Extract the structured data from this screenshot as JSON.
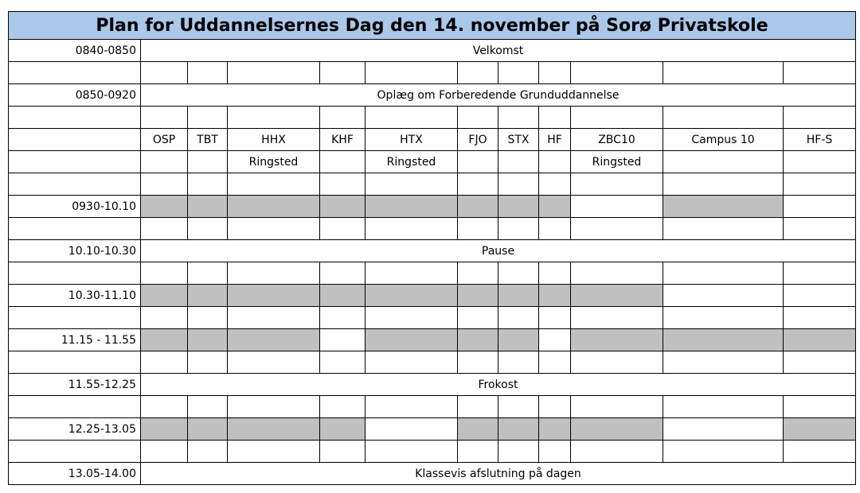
{
  "title": "Plan for Uddannelsernes Dag den 14. november på Sorø Privatskole",
  "columns": [
    "OSP",
    "TBT",
    "HHX",
    "KHF",
    "HTX",
    "FJO",
    "STX",
    "HF",
    "ZBC10",
    "Campus 10",
    "HF-S"
  ],
  "locations": [
    "",
    "",
    "Ringsted",
    "",
    "Ringsted",
    "",
    "",
    "",
    "Ringsted",
    "",
    ""
  ],
  "rows": [
    {
      "time": "0840-0850",
      "label": "Velkomst"
    },
    {
      "time": "",
      "cells": [
        0,
        0,
        0,
        0,
        0,
        0,
        0,
        0,
        0,
        0,
        0
      ]
    },
    {
      "time": "0850-0920",
      "label": "Oplæg om Forberedende Grunduddannelse"
    },
    {
      "time": "",
      "cells": [
        0,
        0,
        0,
        0,
        0,
        0,
        0,
        0,
        0,
        0,
        0
      ]
    },
    {
      "time": "",
      "header": "columns"
    },
    {
      "time": "",
      "header": "locations"
    },
    {
      "time": "",
      "cells": [
        0,
        0,
        0,
        0,
        0,
        0,
        0,
        0,
        0,
        0,
        0
      ]
    },
    {
      "time": "0930-10.10",
      "cells": [
        1,
        1,
        1,
        1,
        1,
        1,
        1,
        1,
        0,
        1,
        0
      ]
    },
    {
      "time": "",
      "cells": [
        0,
        0,
        0,
        0,
        0,
        0,
        0,
        0,
        0,
        0,
        0
      ]
    },
    {
      "time": "10.10-10.30",
      "label": "Pause"
    },
    {
      "time": "",
      "cells": [
        0,
        0,
        0,
        0,
        0,
        0,
        0,
        0,
        0,
        0,
        0
      ]
    },
    {
      "time": "10.30-11.10",
      "cells": [
        1,
        1,
        1,
        1,
        1,
        1,
        1,
        1,
        1,
        0,
        0
      ]
    },
    {
      "time": "",
      "cells": [
        0,
        0,
        0,
        0,
        0,
        0,
        0,
        0,
        0,
        0,
        0
      ]
    },
    {
      "time": "11.15 - 11.55",
      "cells": [
        1,
        1,
        1,
        0,
        1,
        1,
        1,
        0,
        1,
        1,
        1
      ]
    },
    {
      "time": "",
      "cells": [
        0,
        0,
        0,
        0,
        0,
        0,
        0,
        0,
        0,
        0,
        0
      ]
    },
    {
      "time": "11.55-12.25",
      "label": "Frokost"
    },
    {
      "time": "",
      "cells": [
        0,
        0,
        0,
        0,
        0,
        0,
        0,
        0,
        0,
        0,
        0
      ]
    },
    {
      "time": "12.25-13.05",
      "cells": [
        1,
        1,
        1,
        1,
        0,
        1,
        1,
        1,
        1,
        0,
        1
      ]
    },
    {
      "time": "",
      "cells": [
        0,
        0,
        0,
        0,
        0,
        0,
        0,
        0,
        0,
        0,
        0
      ]
    },
    {
      "time": "13.05-14.00",
      "label": "Klassevis afslutning på dagen"
    }
  ]
}
